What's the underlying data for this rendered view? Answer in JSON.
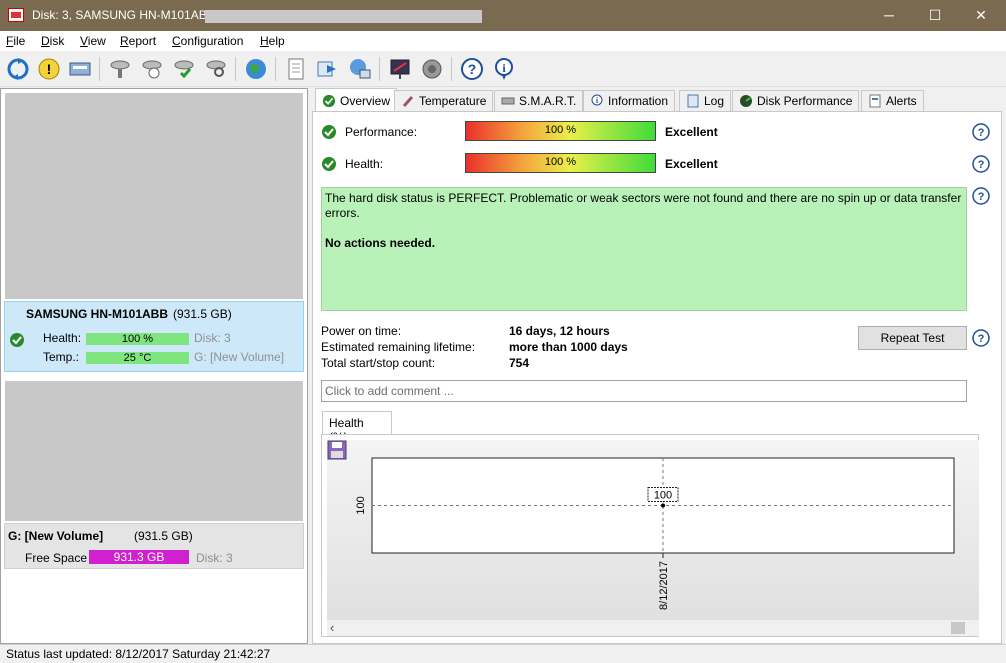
{
  "window": {
    "title": "Disk: 3, SAMSUNG HN-M101ABB",
    "minimize": "─",
    "maximize": "☐",
    "close": "✕"
  },
  "menu": [
    {
      "label": "File",
      "key": "F",
      "rest": "ile"
    },
    {
      "label": "Disk",
      "key": "D",
      "rest": "isk"
    },
    {
      "label": "View",
      "key": "V",
      "rest": "iew"
    },
    {
      "label": "Report",
      "key": "R",
      "rest": "eport"
    },
    {
      "label": "Configuration",
      "key": "C",
      "rest": "onfiguration"
    },
    {
      "label": "Help",
      "key": "H",
      "rest": "elp"
    }
  ],
  "toolbar_icons": [
    "refresh-icon",
    "alert-icon",
    "disk-drive-icon",
    "disk-tool-icon",
    "disk-clock-icon",
    "disk-check-icon",
    "disk-search-icon",
    "globe-icon",
    "document-icon",
    "sync-icon",
    "network-icon",
    "presentation-icon",
    "speaker-icon",
    "help-icon",
    "info-icon"
  ],
  "left": {
    "disk": {
      "name": "SAMSUNG HN-M101ABB",
      "size": "(931.5 GB)",
      "health_label": "Health:",
      "health_value": "100 %",
      "health_level": 100,
      "temp_label": "Temp.:",
      "temp_value": "25 °C",
      "disk_ref": "Disk: 3",
      "volume_ref": "G: [New Volume]"
    },
    "volume": {
      "name": "G: [New Volume]",
      "size": "(931.5 GB)",
      "free_label": "Free Space",
      "free_value": "931.3 GB",
      "disk_ref": "Disk: 3"
    }
  },
  "tabs": [
    {
      "label": "Overview",
      "icon": "check-icon"
    },
    {
      "label": "Temperature",
      "icon": "thermometer-icon"
    },
    {
      "label": "S.M.A.R.T.",
      "icon": "disk-icon"
    },
    {
      "label": "Information",
      "icon": "info-icon"
    },
    {
      "label": "Log",
      "icon": "log-icon"
    },
    {
      "label": "Disk Performance",
      "icon": "gauge-icon"
    },
    {
      "label": "Alerts",
      "icon": "alerts-icon"
    }
  ],
  "overview": {
    "performance_label": "Performance:",
    "performance_value": "100 %",
    "performance_level": 100,
    "performance_rating": "Excellent",
    "health_label": "Health:",
    "health_value": "100 %",
    "health_level": 100,
    "health_rating": "Excellent",
    "status_line1": "The hard disk status is PERFECT. Problematic or weak sectors were not found and there are no spin up or data transfer errors.",
    "status_line2": "No actions needed.",
    "power_on_label": "Power on time:",
    "power_on_value": "16 days, 12 hours",
    "lifetime_label": "Estimated remaining lifetime:",
    "lifetime_value": "more than 1000 days",
    "startstop_label": "Total start/stop count:",
    "startstop_value": "754",
    "repeat_button": "Repeat Test",
    "comment_placeholder": "Click to add comment ...",
    "graph_tab": "Health (%)"
  },
  "chart_data": {
    "type": "line",
    "x": [
      "8/12/2017"
    ],
    "series": [
      {
        "values": [
          100
        ]
      }
    ],
    "ytick": "100",
    "point_label": "100",
    "xtick": "8/12/2017",
    "ylim": [
      0,
      200
    ],
    "grid": false
  },
  "statusbar": {
    "text": "Status last updated: 8/12/2017 Saturday 21:42:27"
  }
}
